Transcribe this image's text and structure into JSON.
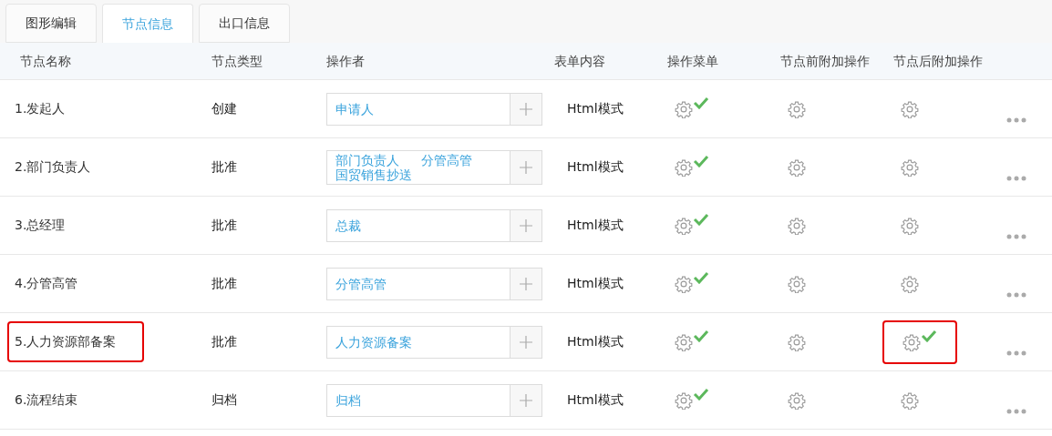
{
  "tabs": [
    {
      "label": "图形编辑",
      "selected": false
    },
    {
      "label": "节点信息",
      "selected": true
    },
    {
      "label": "出口信息",
      "selected": false
    }
  ],
  "table": {
    "columns": [
      "节点名称",
      "节点类型",
      "操作者",
      "表单内容",
      "操作菜单",
      "节点前附加操作",
      "节点后附加操作"
    ],
    "rows": [
      {
        "name": "1.发起人",
        "highlighted": false,
        "type": "创建",
        "operators": [
          "申请人"
        ],
        "form": "Html模式",
        "menu_set": true,
        "pre_set": false,
        "post_set": false,
        "post_highlighted": false
      },
      {
        "name": "2.部门负责人",
        "highlighted": false,
        "type": "批准",
        "operators": [
          "部门负责人",
          "分管高管",
          "国贸销售抄送"
        ],
        "form": "Html模式",
        "menu_set": true,
        "pre_set": false,
        "post_set": false,
        "post_highlighted": false
      },
      {
        "name": "3.总经理",
        "highlighted": false,
        "type": "批准",
        "operators": [
          "总裁"
        ],
        "form": "Html模式",
        "menu_set": true,
        "pre_set": false,
        "post_set": false,
        "post_highlighted": false
      },
      {
        "name": "4.分管高管",
        "highlighted": false,
        "type": "批准",
        "operators": [
          "分管高管"
        ],
        "form": "Html模式",
        "menu_set": true,
        "pre_set": false,
        "post_set": false,
        "post_highlighted": false
      },
      {
        "name": "5.人力资源部备案",
        "highlighted": true,
        "type": "批准",
        "operators": [
          "人力资源备案"
        ],
        "form": "Html模式",
        "menu_set": true,
        "pre_set": false,
        "post_set": true,
        "post_highlighted": true
      },
      {
        "name": "6.流程结束",
        "highlighted": false,
        "type": "归档",
        "operators": [
          "归档"
        ],
        "form": "Html模式",
        "menu_set": true,
        "pre_set": false,
        "post_set": false,
        "post_highlighted": false
      }
    ]
  }
}
